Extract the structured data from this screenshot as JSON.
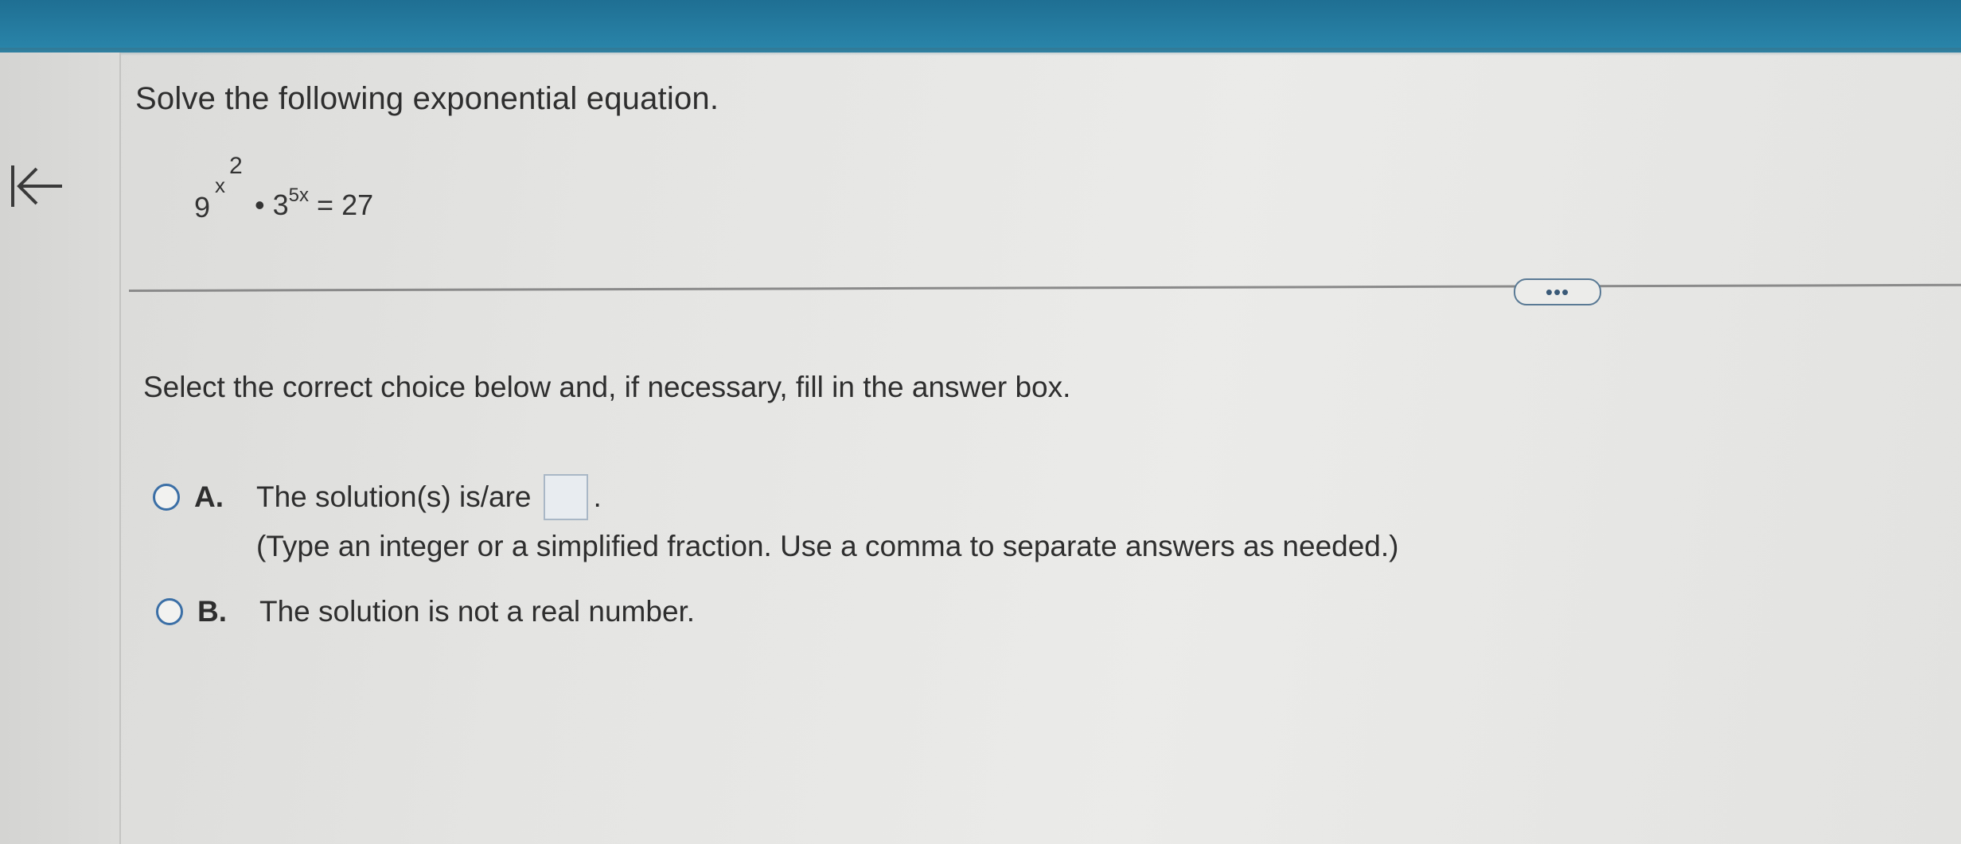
{
  "question": {
    "title": "Solve the following exponential equation.",
    "equation": {
      "base1": "9",
      "base1_exponent_base": "x",
      "base1_exponent_power": "2",
      "operator": "•",
      "base2": "3",
      "base2_exponent": "5x",
      "equals": "=",
      "rhs": "27"
    }
  },
  "more_button_label": "•••",
  "instructions": "Select the correct choice below and, if necessary, fill in the answer box.",
  "choices": [
    {
      "letter": "A.",
      "text": "The solution(s) is/are",
      "answer_value": "",
      "suffix": ".",
      "hint": "(Type an integer or a simplified fraction. Use a comma to separate answers as needed.)"
    },
    {
      "letter": "B.",
      "text": "The solution is not a real number."
    }
  ],
  "colors": {
    "top_bar": "#2a86ab",
    "radio_border": "#3b6fa6",
    "text": "#2e2e2e"
  },
  "icons": {
    "back": "back-to-start-arrow-icon"
  }
}
